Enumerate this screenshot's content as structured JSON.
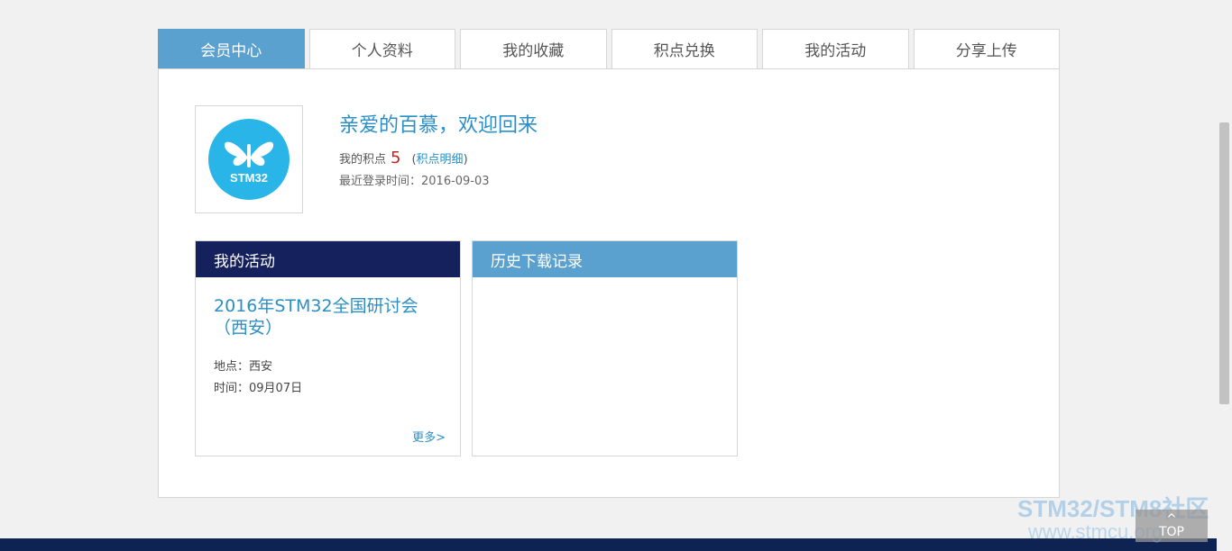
{
  "tabs": [
    {
      "label": "会员中心",
      "active": true
    },
    {
      "label": "个人资料"
    },
    {
      "label": "我的收藏"
    },
    {
      "label": "积点兑换"
    },
    {
      "label": "我的活动"
    },
    {
      "label": "分享上传"
    }
  ],
  "profile": {
    "avatar_text": "STM32",
    "welcome": "亲爱的百慕，欢迎回来",
    "points_label": "我的积点",
    "points_value": "5",
    "points_link_open": "(",
    "points_link": "积点明细",
    "points_link_close": ")",
    "last_login": "最近登录时间：2016-09-03"
  },
  "activity_card": {
    "header": "我的活动",
    "event_title": "2016年STM32全国研讨会（西安）",
    "location": "地点：西安",
    "time": "时间：09月07日",
    "more": "更多>"
  },
  "history_card": {
    "header": "历史下载记录"
  },
  "watermark": {
    "line1": "STM32/STM8社区",
    "line2": "www.stmcu.org"
  },
  "top_button": {
    "arrow": "^",
    "label": "TOP"
  },
  "colors": {
    "accent_blue": "#5aa1cf",
    "navy": "#14215c",
    "link": "#2b8fc6",
    "points_red": "#c4231b",
    "avatar_circle": "#29b5e8"
  }
}
